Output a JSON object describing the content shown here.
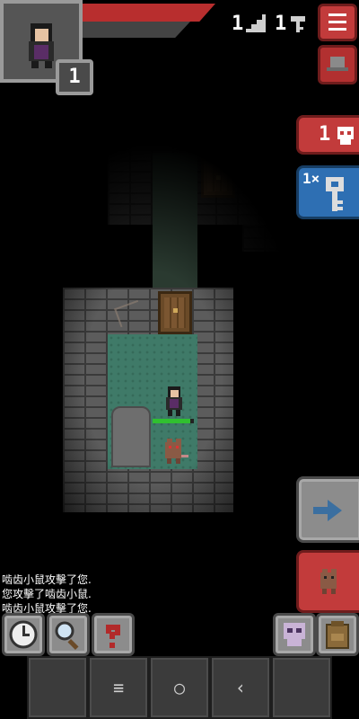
{
  "hud": {
    "hero_level": "1",
    "depth": "1",
    "iron_keys": "1",
    "danger_count": "1",
    "key_count": "1×"
  },
  "messages": [
    "啮齿小鼠攻擊了您.",
    "您攻擊了啮齿小鼠.",
    "啮齿小鼠攻擊了您."
  ],
  "hero_health_fraction": 0.92,
  "colors": {
    "hp": "#b82e2e",
    "danger": "#c23b3b",
    "key_badge": "#2e6fb3",
    "floor": "#3f7a68"
  },
  "icons": {
    "menu": "hamburger-icon",
    "journal": "hat-icon",
    "danger": "skull-icon",
    "key": "iron-key-icon",
    "resume": "arrow-right-icon",
    "attack": "rat-icon",
    "wait": "clock-icon",
    "search": "magnifier-icon",
    "info": "question-icon",
    "quickslot": "skull-item-icon",
    "backpack": "backpack-icon"
  },
  "nav": {
    "menu": "≡",
    "home": "○",
    "back": "‹"
  }
}
